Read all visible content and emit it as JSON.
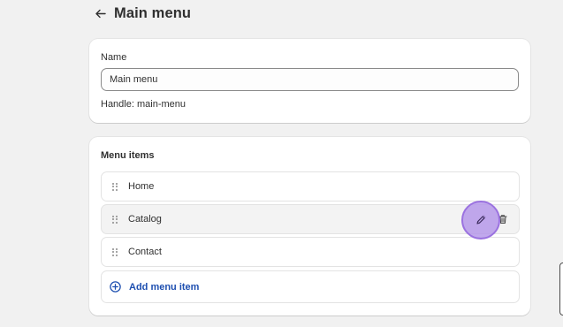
{
  "header": {
    "title": "Main menu",
    "back_icon": "arrow-left-icon"
  },
  "name_card": {
    "name_label": "Name",
    "name_value": "Main menu",
    "handle_text": "Handle: main-menu"
  },
  "menu_card": {
    "title": "Menu items",
    "items": [
      {
        "label": "Home"
      },
      {
        "label": "Catalog"
      },
      {
        "label": "Contact"
      }
    ],
    "add_label": "Add menu item",
    "add_icon": "plus-circle-icon",
    "edit_icon": "pencil-icon",
    "delete_icon": "trash-icon"
  },
  "colors": {
    "background": "#f1f1f1",
    "card": "#ffffff",
    "link": "#1e4fb0",
    "cursor_highlight": "#b292e8"
  }
}
